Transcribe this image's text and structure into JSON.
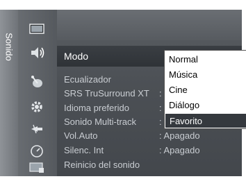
{
  "sidebar": {
    "category_label": "Sonido"
  },
  "icons": [
    "picture-icon",
    "sound-icon",
    "channel-icon",
    "setup-icon",
    "input-icon",
    "application-icon",
    "support-icon"
  ],
  "menu": {
    "items": [
      {
        "label": "Modo",
        "value": ":"
      },
      {
        "label": "Ecualizador",
        "value": ""
      },
      {
        "label": "SRS TruSurround XT",
        "value": ":"
      },
      {
        "label": "Idioma preferido",
        "value": ":"
      },
      {
        "label": "Sonido Multi-track",
        "value": ":"
      },
      {
        "label": "Vol.Auto",
        "value": ": Apagado"
      },
      {
        "label": "Silenc. Int",
        "value": ": Apagado"
      },
      {
        "label": "Reinicio del sonido",
        "value": ""
      }
    ]
  },
  "dropdown": {
    "options": [
      "Normal",
      "Música",
      "Cine",
      "Diálogo",
      "Favorito"
    ],
    "selected": "Favorito"
  }
}
